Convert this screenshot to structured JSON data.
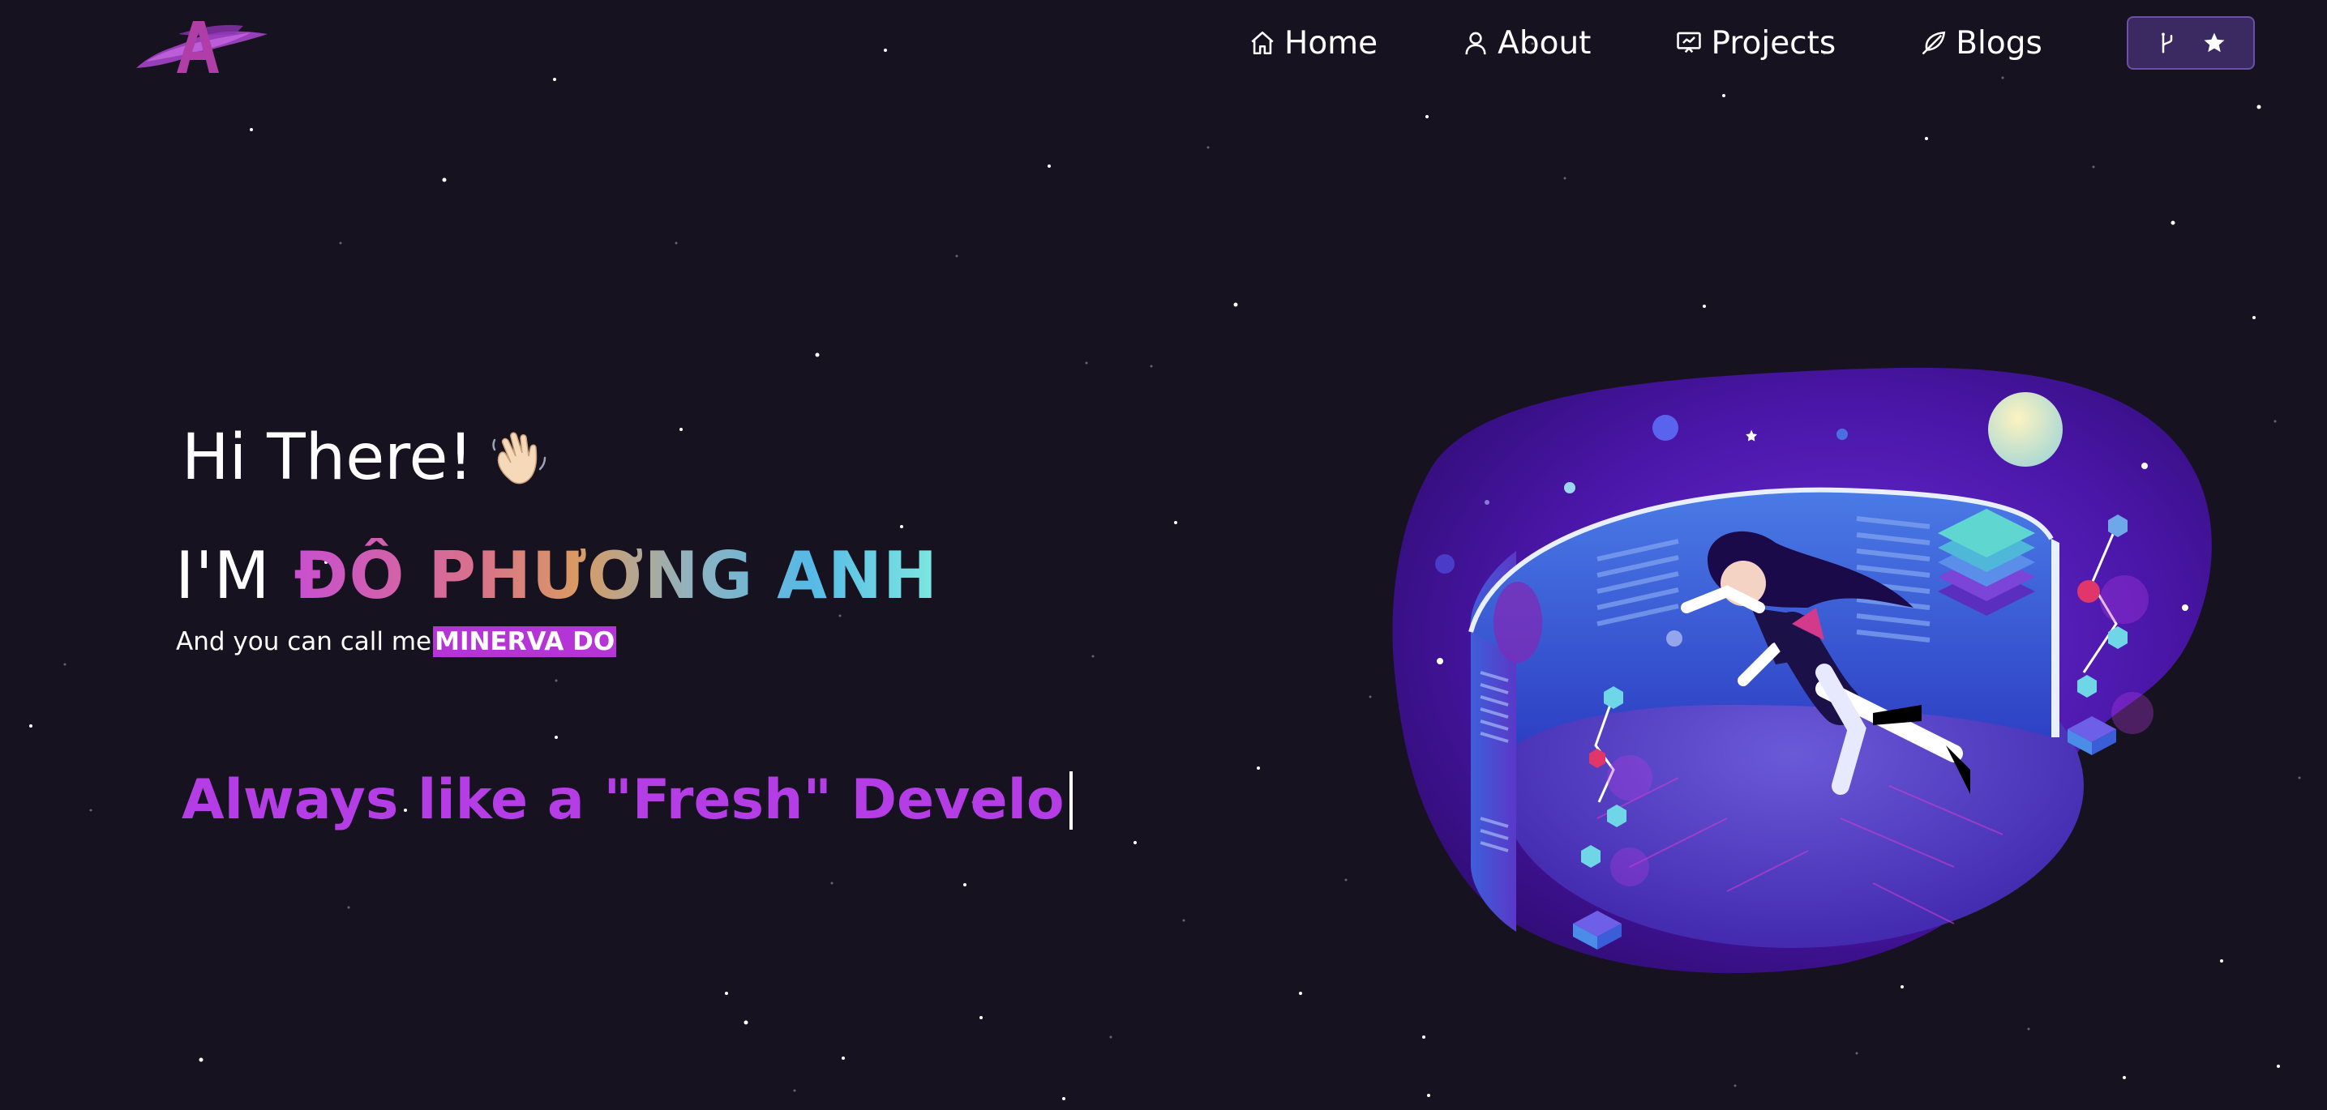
{
  "logo": {
    "letter": "A"
  },
  "nav": {
    "items": [
      {
        "label": "Home",
        "icon": "home-icon"
      },
      {
        "label": "About",
        "icon": "user-icon"
      },
      {
        "label": "Projects",
        "icon": "presentation-icon"
      },
      {
        "label": "Blogs",
        "icon": "feather-icon"
      }
    ],
    "github_button": {
      "icons": [
        "git-fork-icon",
        "star-icon"
      ]
    }
  },
  "hero": {
    "greeting": "Hi There!",
    "greeting_emoji": "waving-hand-icon",
    "name_prefix": "I'M",
    "name": "ĐỖ PHƯƠNG ANH",
    "nickname_prefix": "And you can call me",
    "nickname": "MINERVA DO",
    "typed_text": "Always like a \"Fresh\" Develo"
  },
  "colors": {
    "background": "#16121f",
    "accent": "#b43de6",
    "nickname_highlight": "#b534d6",
    "button_bg": "#3b2a62"
  }
}
